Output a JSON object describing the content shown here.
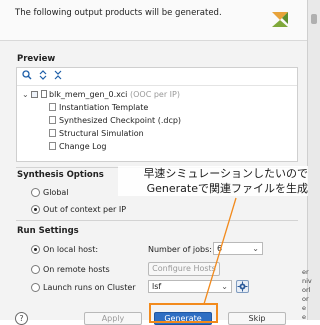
{
  "header": {
    "message": "The following output products will be generated."
  },
  "preview": {
    "title": "Preview",
    "root": {
      "name": "blk_mem_gen_0.xci",
      "note": " (OOC per IP)"
    },
    "children": [
      "Instantiation Template",
      "Synthesized Checkpoint (.dcp)",
      "Structural Simulation",
      "Change Log"
    ]
  },
  "synthesis": {
    "title": "Synthesis Options",
    "global_label": "Global",
    "ooc_label": "Out of context per IP",
    "selected": "Out of context per IP"
  },
  "run": {
    "title": "Run Settings",
    "local_label": "On local host:",
    "remote_label": "On remote hosts",
    "cluster_label": "Launch runs on Cluster",
    "jobs_label": "Number of jobs:",
    "jobs_value": "6",
    "configure_hosts_label": "Configure Hosts",
    "cluster_value": "lsf",
    "selected": "On local host:"
  },
  "annotation": {
    "line1": "早速シミュレーションしたいので",
    "line2": "Generateで関連ファイルを生成"
  },
  "buttons": {
    "help": "?",
    "apply": "Apply",
    "generate": "Generate",
    "skip": "Skip"
  },
  "right_edge": [
    "er",
    "niv",
    "orl",
    "or",
    "e",
    "e"
  ],
  "colors": {
    "accent": "#2f6fc3",
    "highlight": "#f28a1c",
    "background": "#f3f3f3"
  }
}
